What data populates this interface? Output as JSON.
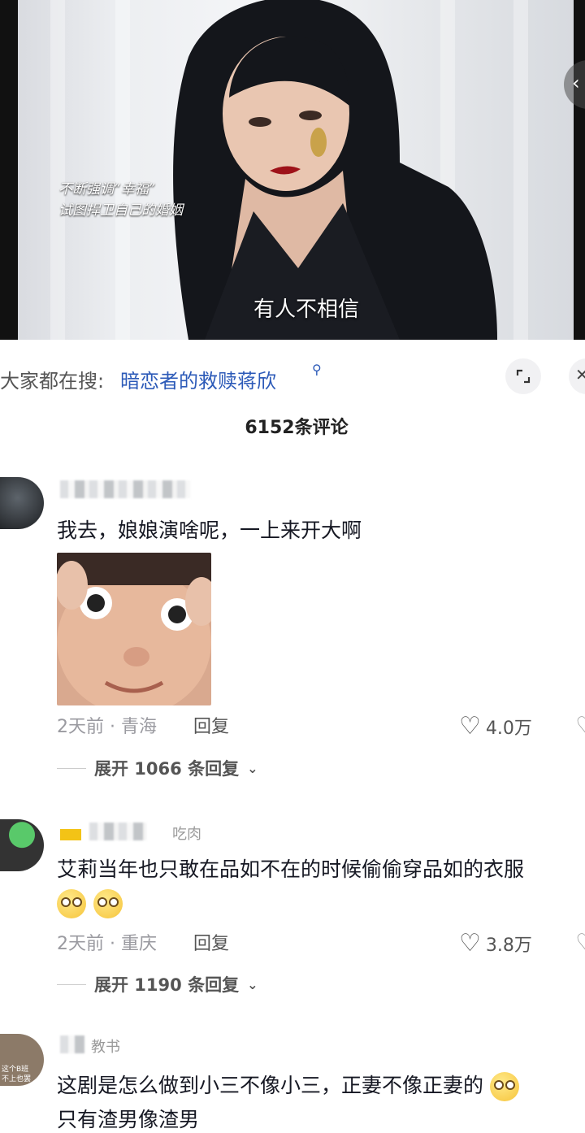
{
  "video": {
    "caption_left_line1": "不断强调“幸福”",
    "caption_left_line2": "试图捍卫自己的婚姻",
    "subtitle": "有人不相信"
  },
  "search": {
    "prefix": "大家都在搜:",
    "term": "暗恋者的救赎蒋欣",
    "icon": "search-icon"
  },
  "comments_header": {
    "count_label": "6152条评论"
  },
  "comments": [
    {
      "text": "我去，娘娘演啥呢，一上来开大啊",
      "meta": "2天前 · 青海",
      "reply_label": "回复",
      "likes": "4.0万",
      "expand_label": "展开 1066 条回复"
    },
    {
      "username": "吃肉",
      "text": "艾莉当年也只敢在品如不在的时候偷偷穿品如的衣服",
      "meta": "2天前 · 重庆",
      "reply_label": "回复",
      "likes": "3.8万",
      "expand_label": "展开 1190 条回复"
    },
    {
      "username": "教书",
      "avatar_text_line1": "这个B班",
      "avatar_text_line2": "不上也罢",
      "text": "这剧是怎么做到小三不像小三，正妻不像正妻的",
      "text_line2": "只有渣男像渣男"
    }
  ],
  "colors": {
    "link": "#2c5ab8",
    "muted": "#9a9aa0",
    "text": "#161823"
  }
}
